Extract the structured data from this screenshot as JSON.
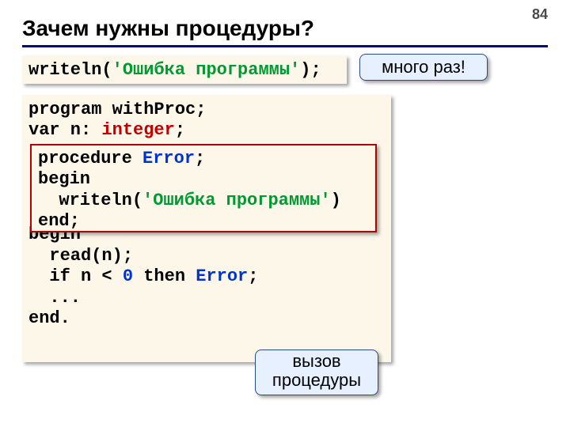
{
  "pageNumber": "84",
  "title": "Зачем нужны процедуры?",
  "topCode": {
    "writeln": "writeln",
    "open": "(",
    "str": "'Ошибка программы'",
    "close": ");"
  },
  "calloutMany": "много раз!",
  "mainCode": {
    "l1a": "program",
    "l1b": " withProc;",
    "l2a": "var",
    "l2b": " n: ",
    "l2c": "integer",
    "l2d": ";",
    "gap1": " ",
    "gap2": " ",
    "gap3": " ",
    "gap4": " ",
    "l7": "begin",
    "l8": "  read(n);",
    "l9a": "  ",
    "l9b": "if",
    "l9c": " n < ",
    "l9d": "0",
    "l9e": " ",
    "l9f": "then",
    "l9g": " ",
    "l9h": "Error",
    "l9i": ";",
    "l10": "  ...",
    "l11": "end."
  },
  "procCode": {
    "l1a": "procedure",
    "l1b": " ",
    "l1c": "Error",
    "l1d": ";",
    "l2": "begin",
    "l3a": "  writeln(",
    "l3b": "'Ошибка программы'",
    "l3c": ")",
    "l4": "end;"
  },
  "calloutCall": "вызов\nпроцедуры"
}
